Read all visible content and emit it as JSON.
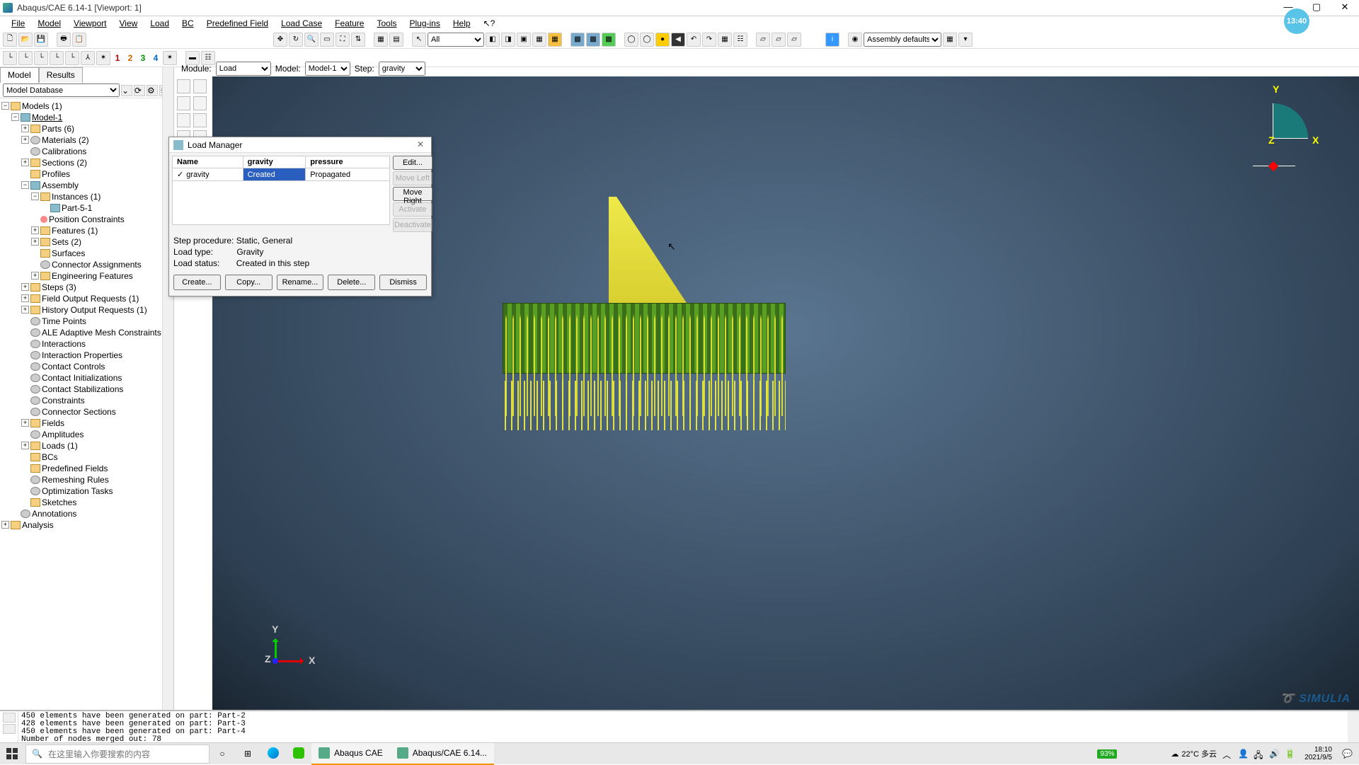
{
  "window": {
    "title": "Abaqus/CAE 6.14-1 [Viewport: 1]",
    "time_badge": "13:40"
  },
  "menubar": [
    "File",
    "Model",
    "Viewport",
    "View",
    "Load",
    "BC",
    "Predefined Field",
    "Load Case",
    "Feature",
    "Tools",
    "Plug-ins",
    "Help"
  ],
  "context": {
    "panel_selector": "Model Database",
    "module_label": "Module:",
    "module_value": "Load",
    "model_label": "Model:",
    "model_value": "Model-1",
    "step_label": "Step:",
    "step_value": "gravity"
  },
  "tabs": {
    "model": "Model",
    "results": "Results"
  },
  "tree": {
    "root": "Models (1)",
    "model": "Model-1",
    "nodes": [
      "Parts (6)",
      "Materials (2)",
      "Calibrations",
      "Sections (2)",
      "Profiles",
      "Assembly",
      "Instances (1)",
      "Part-5-1",
      "Position Constraints",
      "Features (1)",
      "Sets (2)",
      "Surfaces",
      "Connector Assignments",
      "Engineering Features",
      "Steps (3)",
      "Field Output Requests (1)",
      "History Output Requests (1)",
      "Time Points",
      "ALE Adaptive Mesh Constraints",
      "Interactions",
      "Interaction Properties",
      "Contact Controls",
      "Contact Initializations",
      "Contact Stabilizations",
      "Constraints",
      "Connector Sections",
      "Fields",
      "Amplitudes",
      "Loads (1)",
      "BCs",
      "Predefined Fields",
      "Remeshing Rules",
      "Optimization Tasks",
      "Sketches"
    ],
    "annotations": "Annotations",
    "analysis": "Analysis"
  },
  "dialog": {
    "title": "Load Manager",
    "headers": [
      "Name",
      "gravity",
      "pressure"
    ],
    "row": {
      "name": "gravity",
      "c1": "Created",
      "c2": "Propagated"
    },
    "side_buttons": {
      "edit": "Edit...",
      "move_left": "Move Left",
      "move_right": "Move Right",
      "activate": "Activate",
      "deactivate": "Deactivate"
    },
    "info": {
      "step_proc_label": "Step procedure:",
      "step_proc": "Static, General",
      "load_type_label": "Load type:",
      "load_type": "Gravity",
      "load_status_label": "Load status:",
      "load_status": "Created in this step"
    },
    "buttons": {
      "create": "Create...",
      "copy": "Copy...",
      "rename": "Rename...",
      "delete": "Delete...",
      "dismiss": "Dismiss"
    }
  },
  "toolbar": {
    "visibility_selector": "All",
    "render_selector": "Assembly defaults"
  },
  "viewport": {
    "axis_x": "X",
    "axis_y": "Y",
    "axis_z": "Z",
    "logo": "SIMULIA"
  },
  "console": {
    "lines": "450 elements have been generated on part: Part-2\n428 elements have been generated on part: Part-3\n450 elements have been generated on part: Part-4\nNumber of nodes merged out: 78",
    "prompt": ">>>"
  },
  "taskbar": {
    "search_placeholder": "在这里输入你要搜索的内容",
    "tasks": {
      "abaqus": "Abaqus CAE",
      "abaqus_viewport": "Abaqus/CAE 6.14..."
    },
    "battery": "93%",
    "weather": "22°C 多云",
    "time": "18:10",
    "date": "2021/9/5"
  }
}
